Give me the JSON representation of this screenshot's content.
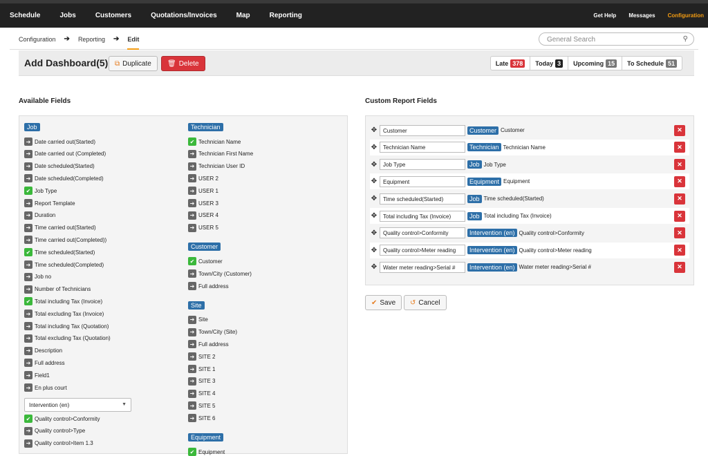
{
  "nav": {
    "items": [
      "Schedule",
      "Jobs",
      "Customers",
      "Quotations/Invoices",
      "Map",
      "Reporting"
    ],
    "right": [
      "Get Help",
      "Messages",
      "Configuration"
    ]
  },
  "breadcrumb": {
    "items": [
      "Configuration",
      "Reporting",
      "Edit"
    ]
  },
  "search": {
    "placeholder": "General Search"
  },
  "header": {
    "title": "Add Dashboard(5)",
    "duplicate": "Duplicate",
    "delete": "Delete",
    "stats": [
      {
        "label": "Late",
        "count": "378",
        "color": "#d9343a"
      },
      {
        "label": "Today",
        "count": "3",
        "color": "#222"
      },
      {
        "label": "Upcoming",
        "count": "15",
        "color": "#777"
      },
      {
        "label": "To Schedule",
        "count": "51",
        "color": "#777"
      }
    ]
  },
  "available": {
    "title": "Available Fields",
    "left": {
      "category": "Job",
      "fields": [
        {
          "label": "Date carried out(Started)",
          "checked": false
        },
        {
          "label": "Date carried out (Completed)",
          "checked": false
        },
        {
          "label": "Date scheduled(Started)",
          "checked": false
        },
        {
          "label": "Date scheduled(Completed)",
          "checked": false
        },
        {
          "label": "Job Type",
          "checked": true
        },
        {
          "label": "Report Template",
          "checked": false
        },
        {
          "label": "Duration",
          "checked": false
        },
        {
          "label": "Time carried out(Started)",
          "checked": false
        },
        {
          "label": "Time carried out(Completed))",
          "checked": false
        },
        {
          "label": "Time scheduled(Started)",
          "checked": true
        },
        {
          "label": "Time scheduled(Completed)",
          "checked": false
        },
        {
          "label": "Job no",
          "checked": false
        },
        {
          "label": "Number of Technicians",
          "checked": false
        },
        {
          "label": "Total including Tax (Invoice)",
          "checked": true
        },
        {
          "label": "Total excluding Tax (Invoice)",
          "checked": false
        },
        {
          "label": "Total including Tax (Quotation)",
          "checked": false
        },
        {
          "label": "Total excluding Tax (Quotation)",
          "checked": false
        },
        {
          "label": "Description",
          "checked": false
        },
        {
          "label": "Full address",
          "checked": false
        },
        {
          "label": "Field1",
          "checked": false
        },
        {
          "label": "En plus court",
          "checked": false
        }
      ],
      "select": "Intervention (en)",
      "extra": [
        {
          "label": "Quality control>Conformity",
          "checked": true
        },
        {
          "label": "Quality control>Type",
          "checked": false
        },
        {
          "label": "Quality control>Item 1.3",
          "checked": false
        }
      ]
    },
    "right": [
      {
        "category": "Technician",
        "fields": [
          {
            "label": "Technician Name",
            "checked": true
          },
          {
            "label": "Technician First Name",
            "checked": false
          },
          {
            "label": "Technician User ID",
            "checked": false
          },
          {
            "label": "USER 2",
            "checked": false
          },
          {
            "label": "USER 1",
            "checked": false
          },
          {
            "label": "USER 3",
            "checked": false
          },
          {
            "label": "USER 4",
            "checked": false
          },
          {
            "label": "USER 5",
            "checked": false
          }
        ]
      },
      {
        "category": "Customer",
        "fields": [
          {
            "label": "Customer",
            "checked": true
          },
          {
            "label": "Town/City (Customer)",
            "checked": false
          },
          {
            "label": "Full address",
            "checked": false
          }
        ]
      },
      {
        "category": "Site",
        "fields": [
          {
            "label": "Site",
            "checked": false
          },
          {
            "label": "Town/City (Site)",
            "checked": false
          },
          {
            "label": "Full address",
            "checked": false
          },
          {
            "label": "SITE 2",
            "checked": false
          },
          {
            "label": "SITE 1",
            "checked": false
          },
          {
            "label": "SITE 3",
            "checked": false
          },
          {
            "label": "SITE 4",
            "checked": false
          },
          {
            "label": "SITE 5",
            "checked": false
          },
          {
            "label": "SITE 6",
            "checked": false
          }
        ]
      },
      {
        "category": "Equipment",
        "fields": [
          {
            "label": "Equipment",
            "checked": true
          }
        ]
      }
    ]
  },
  "custom": {
    "title": "Custom Report Fields",
    "rows": [
      {
        "value": "Customer",
        "tag": "Customer",
        "label": "Customer"
      },
      {
        "value": "Technician Name",
        "tag": "Technician",
        "label": "Technician Name"
      },
      {
        "value": "Job Type",
        "tag": "Job",
        "label": "Job Type"
      },
      {
        "value": "Equipment",
        "tag": "Equipment",
        "label": "Equipment"
      },
      {
        "value": "Time scheduled(Started)",
        "tag": "Job",
        "label": "Time scheduled(Started)"
      },
      {
        "value": "Total including Tax (Invoice)",
        "tag": "Job",
        "label": "Total including Tax (Invoice)"
      },
      {
        "value": "Quality control>Conformity",
        "tag": "Intervention (en)",
        "label": "Quality control>Conformity"
      },
      {
        "value": "Quality control>Meter reading",
        "tag": "Intervention (en)",
        "label": "Quality control>Meter reading"
      },
      {
        "value": "Water meter reading>Serial #",
        "tag": "Intervention (en)",
        "label": "Water meter reading>Serial #"
      }
    ]
  },
  "actions": {
    "save": "Save",
    "cancel": "Cancel"
  }
}
